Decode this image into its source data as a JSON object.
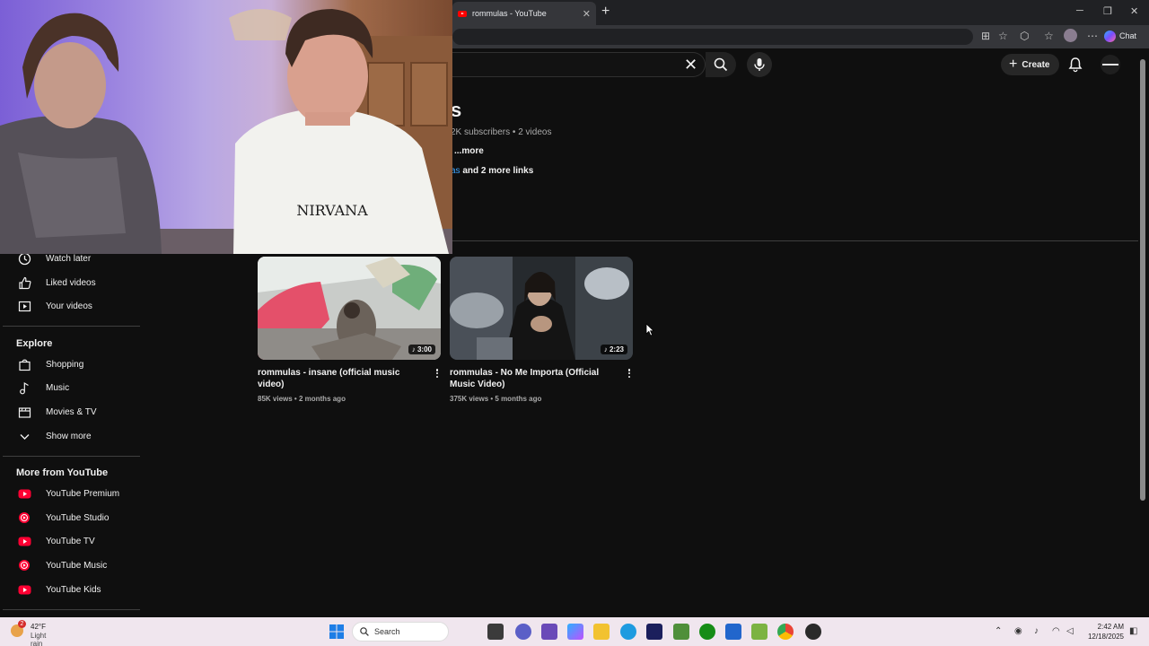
{
  "browser": {
    "tab_title": "rommulas - YouTube",
    "copilot_label": "Chat"
  },
  "header": {
    "create_label": "Create"
  },
  "channel": {
    "name_visible": "s",
    "meta": "2K subscribers • 2 videos",
    "more": "...more",
    "links_prefix": "as",
    "links_suffix": " and 2 more links"
  },
  "sidebar": {
    "top_items": [
      {
        "label": "Watch later",
        "icon": "clock-icon"
      },
      {
        "label": "Liked videos",
        "icon": "thumbs-up-icon"
      },
      {
        "label": "Your videos",
        "icon": "play-square-icon"
      }
    ],
    "explore_heading": "Explore",
    "explore_items": [
      {
        "label": "Shopping",
        "icon": "shopping-bag-icon"
      },
      {
        "label": "Music",
        "icon": "music-note-icon"
      },
      {
        "label": "Movies & TV",
        "icon": "clapperboard-icon"
      },
      {
        "label": "Show more",
        "icon": "chevron-down-icon"
      }
    ],
    "more_heading": "More from YouTube",
    "more_items": [
      {
        "label": "YouTube Premium",
        "icon": "youtube-premium-icon"
      },
      {
        "label": "YouTube Studio",
        "icon": "youtube-studio-icon"
      },
      {
        "label": "YouTube TV",
        "icon": "youtube-tv-icon"
      },
      {
        "label": "YouTube Music",
        "icon": "youtube-music-icon"
      },
      {
        "label": "YouTube Kids",
        "icon": "youtube-kids-icon"
      }
    ]
  },
  "videos": [
    {
      "title": "rommulas - insane (official music video)",
      "views": "85K views",
      "age": "2 months ago",
      "duration": "3:00"
    },
    {
      "title": "rommulas - No Me Importa (Official Music Video)",
      "views": "375K views",
      "age": "5 months ago",
      "duration": "2:23"
    }
  ],
  "webcam": {
    "shirt_text": "NIRVANA"
  },
  "taskbar": {
    "weather_temp": "42°F",
    "weather_condition": "Light rain",
    "weather_badge": "2",
    "search_label": "Search",
    "time": "2:42 AM",
    "date": "12/18/2025"
  },
  "colors": {
    "background": "#0f0f0f",
    "youtube_red": "#ff0000",
    "link_blue": "#3ea6ff",
    "taskbar": "#f0e6ee"
  }
}
